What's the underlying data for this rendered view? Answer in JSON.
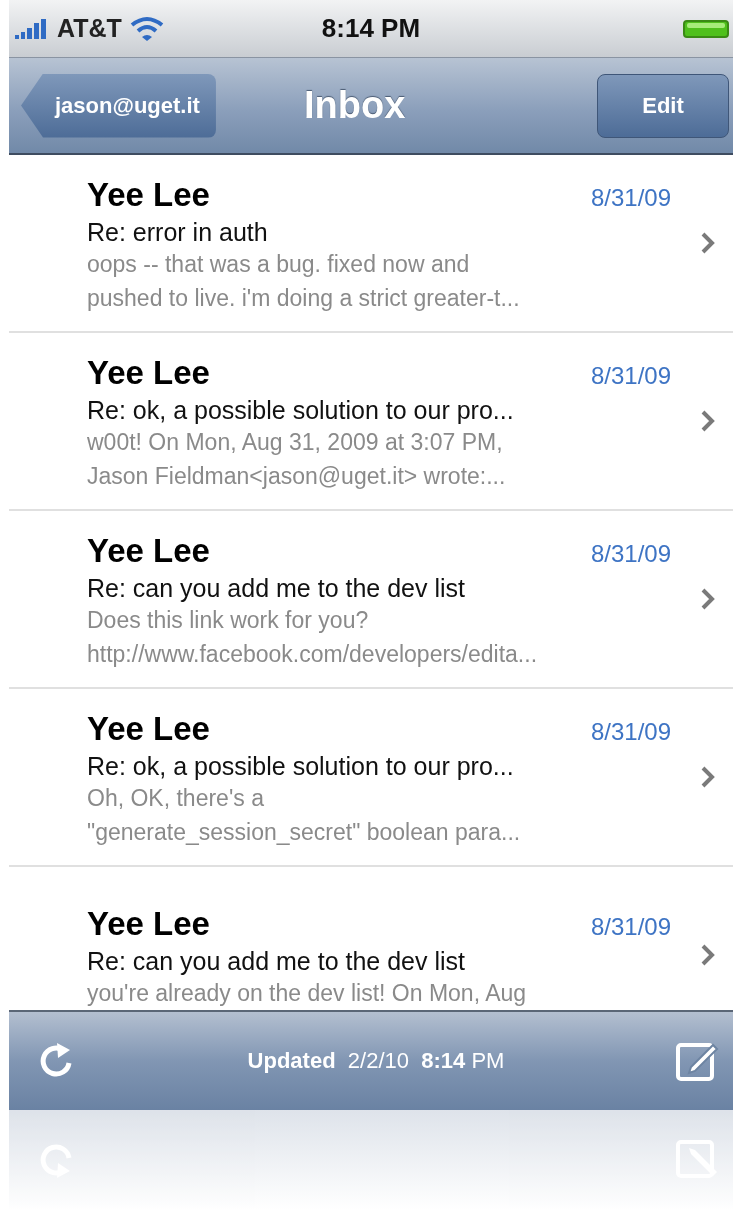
{
  "status_bar": {
    "carrier": "AT&T",
    "time": "8:14 PM"
  },
  "nav_bar": {
    "back_button": "jason@uget.it",
    "title": "Inbox",
    "edit_button": "Edit"
  },
  "messages": [
    {
      "sender": "Yee Lee",
      "date": "8/31/09",
      "subject": "Re: error in auth",
      "preview": [
        "oops -- that was a bug. fixed now and",
        "pushed to live. i'm doing a strict greater-t..."
      ]
    },
    {
      "sender": "Yee Lee",
      "date": "8/31/09",
      "subject": "Re: ok, a possible solution to our pro...",
      "preview": [
        "w00t! On Mon, Aug 31, 2009 at 3:07 PM,",
        "Jason Fieldman<jason@uget.it> wrote:..."
      ]
    },
    {
      "sender": "Yee Lee",
      "date": "8/31/09",
      "subject": "Re: can you add me to the dev list",
      "preview": [
        "Does this link work for you?",
        "http://www.facebook.com/developers/edita..."
      ]
    },
    {
      "sender": "Yee Lee",
      "date": "8/31/09",
      "subject": "Re: ok, a possible solution to our pro...",
      "preview": [
        "Oh, OK, there's a",
        "\"generate_session_secret\" boolean para..."
      ]
    },
    {
      "sender": "Yee Lee",
      "date": "8/31/09",
      "subject": "Re: can you add me to the dev list",
      "preview": [
        "you're already on the dev list! On Mon, Aug"
      ]
    }
  ],
  "toolbar": {
    "status": "**Updated**  2/2/10  **8:14** PM"
  }
}
